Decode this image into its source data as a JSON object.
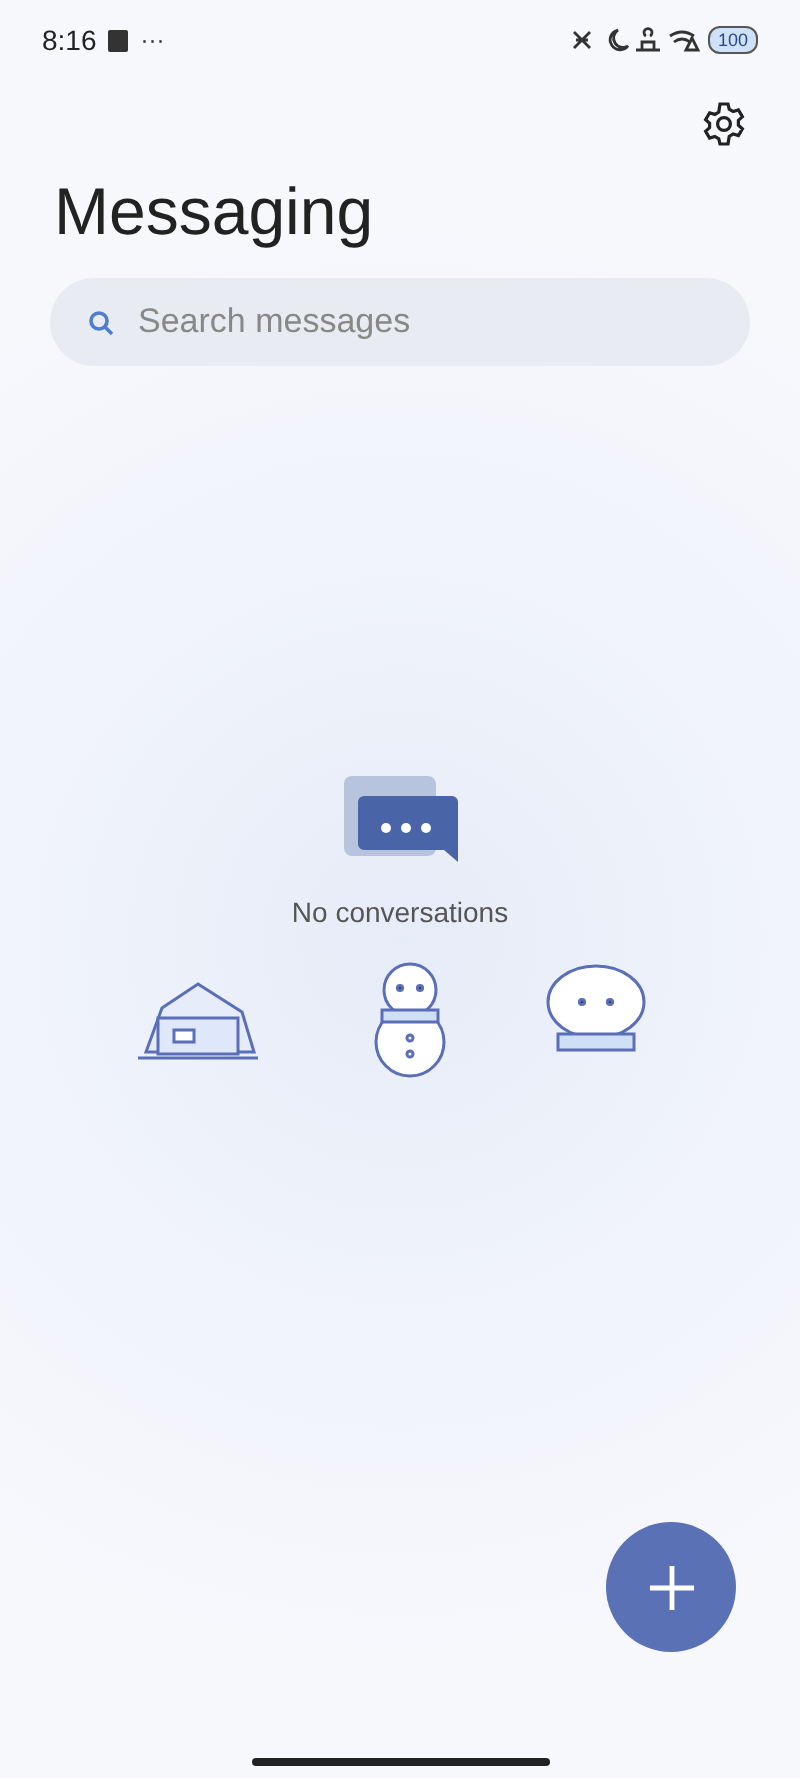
{
  "status_bar": {
    "time": "8:16",
    "overflow": "···",
    "battery": "100"
  },
  "title": "Messaging",
  "search": {
    "placeholder": "Search messages"
  },
  "empty_state": {
    "text": "No conversations"
  }
}
